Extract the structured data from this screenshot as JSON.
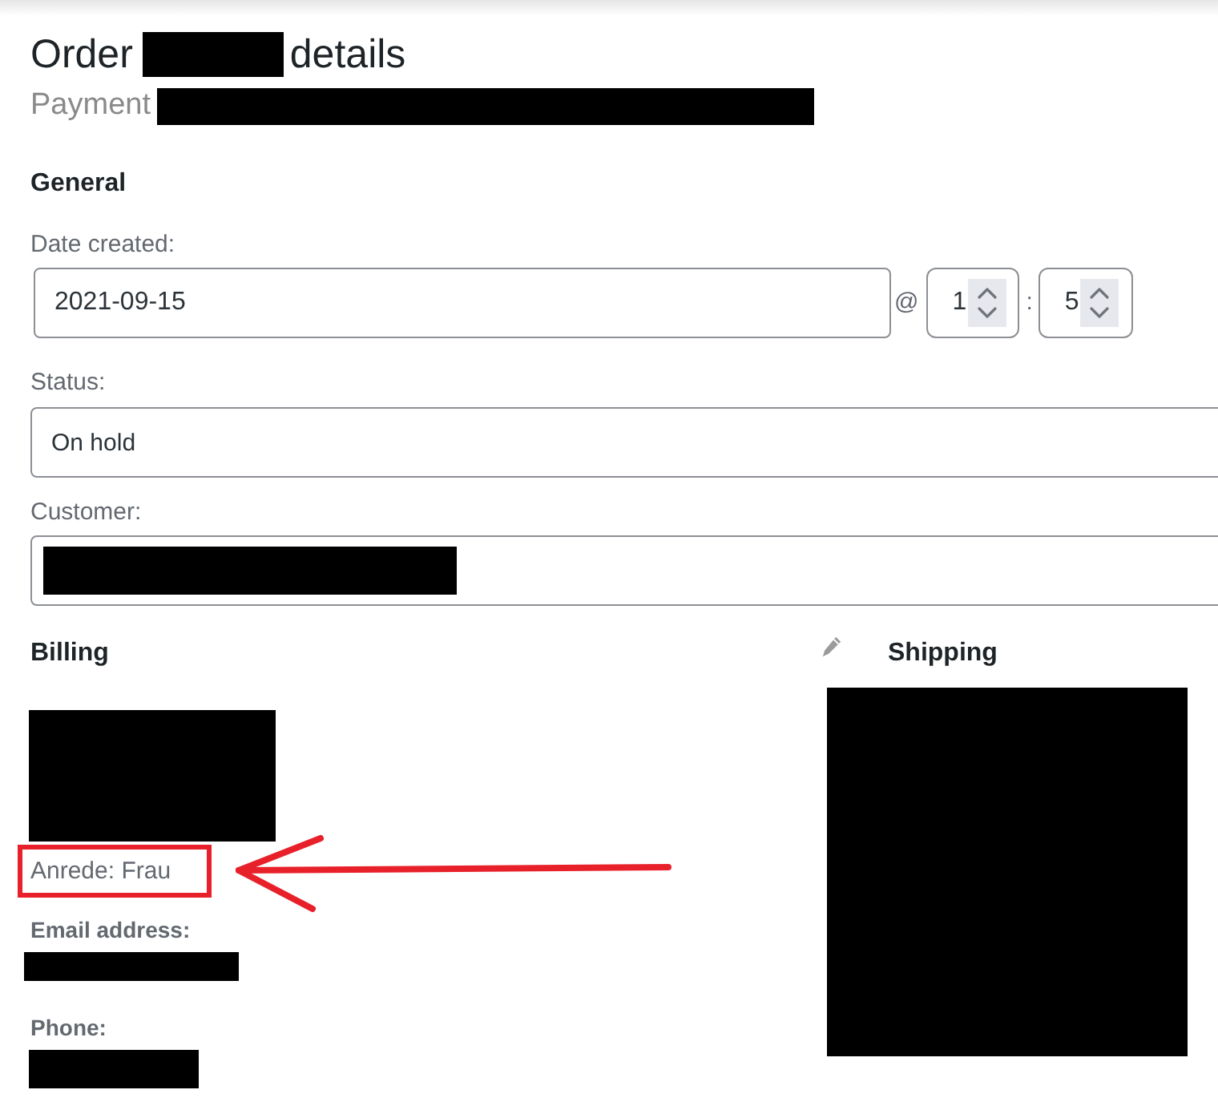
{
  "header": {
    "title": {
      "before": "Order",
      "redacted": true,
      "after": "details"
    },
    "subtitle": {
      "text": "Payment",
      "redacted": true
    }
  },
  "general": {
    "heading": "General",
    "date_created": {
      "label": "Date created:",
      "date": "2021-09-15",
      "at": "@",
      "hour": "1",
      "colon": ":",
      "minute": "5"
    },
    "status": {
      "label": "Status:",
      "value": "On hold"
    },
    "customer": {
      "label": "Customer:",
      "redacted": true
    }
  },
  "billing": {
    "heading": "Billing",
    "address_redacted": true,
    "salutation": {
      "text": "Anrede: Frau",
      "highlighted": true
    },
    "fields": [
      {
        "label": "Email address:",
        "redacted": true
      },
      {
        "label": "Phone:",
        "redacted": true
      }
    ]
  },
  "shipping": {
    "heading": "Shipping",
    "address_redacted": true
  }
}
